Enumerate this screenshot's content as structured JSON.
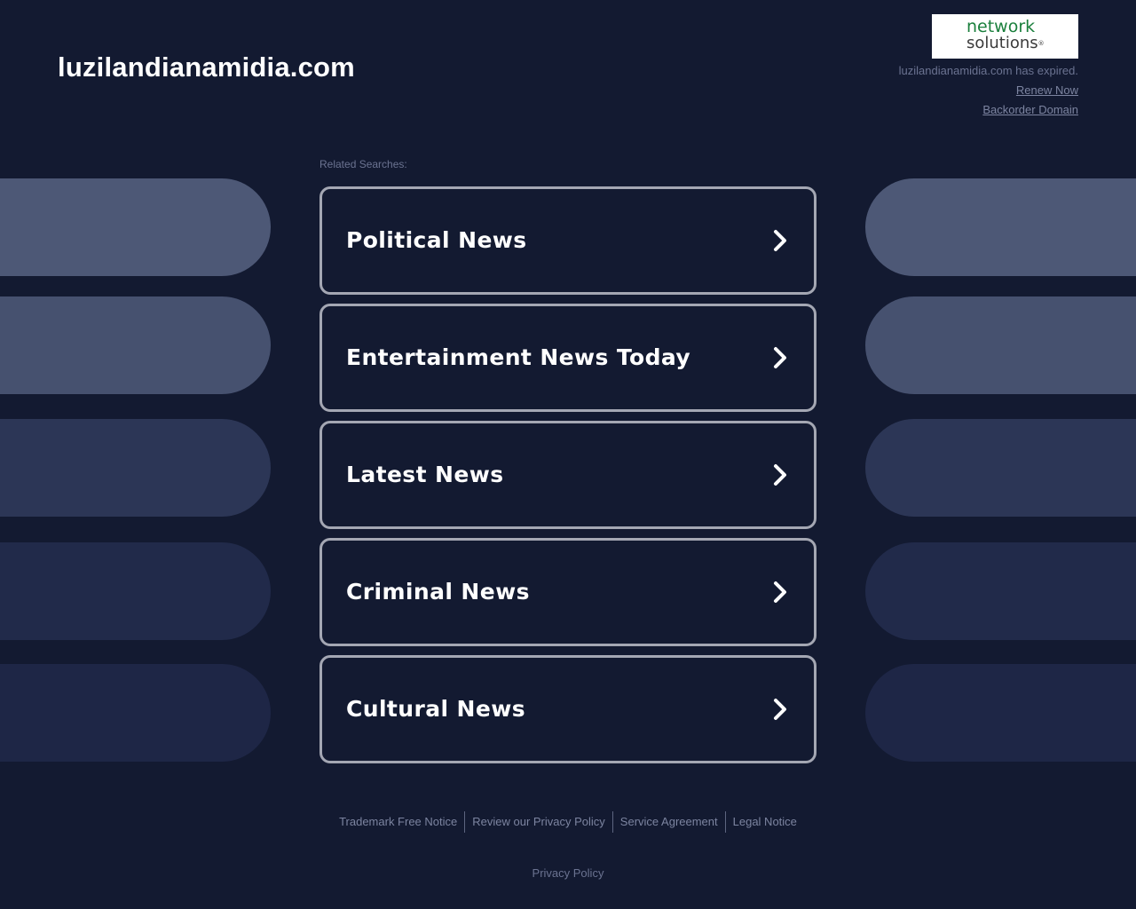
{
  "header": {
    "domain": "luzilandianamidia.com",
    "brand": {
      "line1": "network",
      "line2": "solutions",
      "reg_mark": "®",
      "line1_color": "#1a7f3c",
      "line2_color": "#3b3b3b"
    },
    "expired_text": "luzilandianamidia.com has expired.",
    "renew_label": "Renew Now",
    "backorder_label": "Backorder Domain"
  },
  "related": {
    "label": "Related Searches:",
    "items": [
      {
        "label": "Political News"
      },
      {
        "label": "Entertainment News Today"
      },
      {
        "label": "Latest News"
      },
      {
        "label": "Criminal News"
      },
      {
        "label": "Cultural News"
      }
    ]
  },
  "decor": {
    "pill_colors": [
      "#4d5876",
      "#4d5876",
      "#2c3656",
      "#1f2849",
      "#1d2545"
    ]
  },
  "footer": {
    "links": [
      {
        "label": "Trademark Free Notice"
      },
      {
        "label": "Review our Privacy Policy"
      },
      {
        "label": "Service Agreement"
      },
      {
        "label": "Legal Notice"
      }
    ],
    "privacy_policy": "Privacy Policy"
  },
  "colors": {
    "background": "#131a31",
    "card_border": "#a4a7b3",
    "text_primary": "#ffffff",
    "text_muted": "#6b7391"
  }
}
